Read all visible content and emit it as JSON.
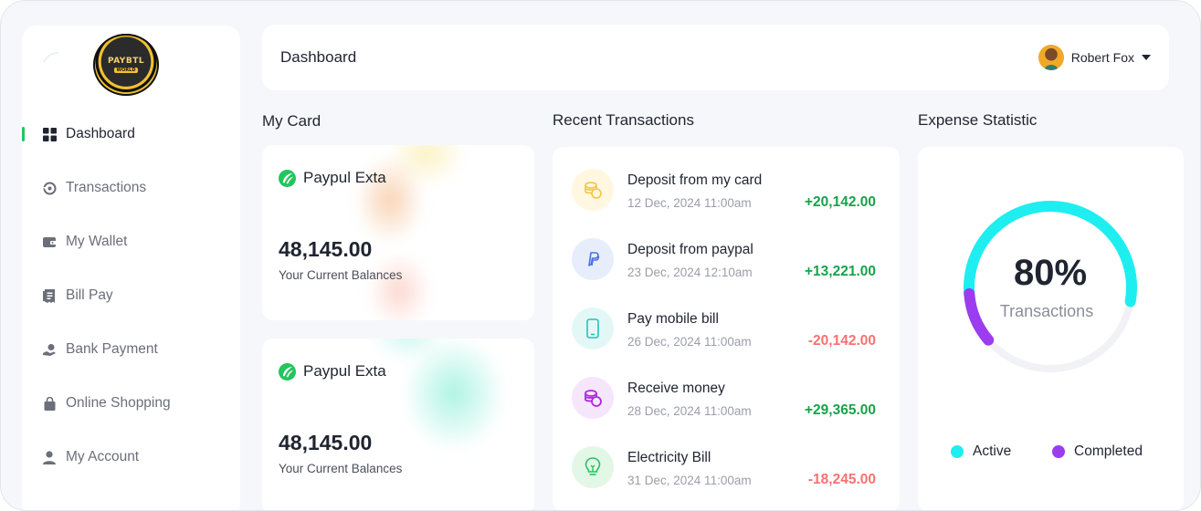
{
  "logo": {
    "text": "PAYBTL",
    "subtext": "WORLD"
  },
  "sidebar": {
    "items": [
      {
        "label": "Dashboard",
        "icon": "dashboard-grid-icon",
        "active": true
      },
      {
        "label": "Transactions",
        "icon": "transactions-icon"
      },
      {
        "label": "My Wallet",
        "icon": "wallet-icon"
      },
      {
        "label": "Bill Pay",
        "icon": "bill-icon"
      },
      {
        "label": "Bank Payment",
        "icon": "bank-payment-icon"
      },
      {
        "label": "Online Shopping",
        "icon": "shopping-bag-icon"
      },
      {
        "label": "My Account",
        "icon": "user-icon"
      }
    ]
  },
  "header": {
    "title": "Dashboard",
    "user_name": "Robert Fox"
  },
  "my_card": {
    "title": "My Card",
    "cards": [
      {
        "brand": "Paypul Exta",
        "balance": "48,145.00",
        "caption": "Your Current Balances"
      },
      {
        "brand": "Paypul Exta",
        "balance": "48,145.00",
        "caption": "Your Current Balances"
      }
    ]
  },
  "recent_transactions": {
    "title": "Recent Transactions",
    "items": [
      {
        "title": "Deposit from my card",
        "date": "12 Dec, 2024 11:00am",
        "amount": "+20,142.00",
        "type": "credit",
        "icon": "coins-icon",
        "bg": "#fff7e0",
        "color": "#f5c542"
      },
      {
        "title": "Deposit from paypal",
        "date": "23 Dec, 2024 12:10am",
        "amount": "+13,221.00",
        "type": "credit",
        "icon": "paypal-icon",
        "bg": "#e8edfc",
        "color": "#4f6fe8"
      },
      {
        "title": "Pay mobile bill",
        "date": "26 Dec, 2024 11:00am",
        "amount": "-20,142.00",
        "type": "debit",
        "icon": "mobile-icon",
        "bg": "#e3f8f6",
        "color": "#22c3b5"
      },
      {
        "title": "Receive money",
        "date": "28 Dec, 2024 11:00am",
        "amount": "+29,365.00",
        "type": "credit",
        "icon": "coins-icon",
        "bg": "#f6e6fb",
        "color": "#b026e0"
      },
      {
        "title": "Electricity Bill",
        "date": "31 Dec, 2024 11:00am",
        "amount": "-18,245.00",
        "type": "debit",
        "icon": "lightbulb-icon",
        "bg": "#e3f7e6",
        "color": "#22c55e"
      }
    ]
  },
  "expense_statistic": {
    "title": "Expense Statistic",
    "percent_label": "80%",
    "caption": "Transactions",
    "active_fraction": 0.54,
    "completed_fraction": 0.1,
    "legend": [
      {
        "label": "Active",
        "color": "#1eeef0"
      },
      {
        "label": "Completed",
        "color": "#9b3cf0"
      }
    ]
  }
}
